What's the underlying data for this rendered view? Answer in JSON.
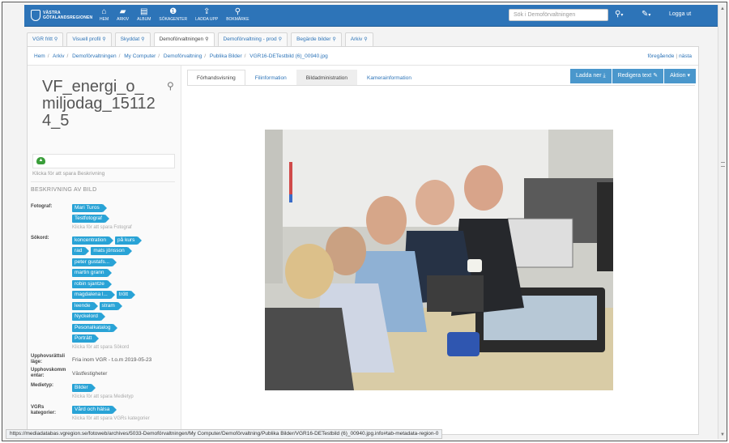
{
  "nav": {
    "logo_line1": "VÄSTRA",
    "logo_line2": "GÖTALANDSREGIONEN",
    "items": [
      {
        "label": "HEM",
        "icon": "home-icon"
      },
      {
        "label": "ARKIV",
        "icon": "folder-icon"
      },
      {
        "label": "ALBUM",
        "icon": "album-icon"
      },
      {
        "label": "SÖKAGENTER",
        "icon": "info-icon"
      },
      {
        "label": "LADDA UPP",
        "icon": "upload-icon"
      },
      {
        "label": "BOKMÄRKE",
        "icon": "pin-icon"
      }
    ],
    "search_placeholder": "Sök i Demoförvaltningen",
    "logout": "Logga ut"
  },
  "tabs": [
    {
      "label": "VGR fritt",
      "active": false
    },
    {
      "label": "Visuell profil",
      "active": false
    },
    {
      "label": "Skyddat",
      "active": false
    },
    {
      "label": "Demoförvaltningen",
      "active": true
    },
    {
      "label": "Demoförvaltning - prod",
      "active": false
    },
    {
      "label": "Begärde bilder",
      "active": false
    },
    {
      "label": "Arkiv",
      "active": false
    }
  ],
  "breadcrumb": [
    "Hem",
    "Arkiv",
    "Demoförvaltningen",
    "My Computer",
    "Demoförvaltning",
    "Publika Bilder",
    "VGR16-DETestbild (6)_00940.jpg"
  ],
  "prev_label": "föregående",
  "next_label": "nästa",
  "asset": {
    "title": "VF_energi_o_miljodag_151124_5",
    "click_description": "Klicka för att spara Beskrivning",
    "section_heading": "BESKRIVNING AV BILD"
  },
  "fields": {
    "photographer": {
      "label": "Fotograf:",
      "tags": [
        "Mari Turos",
        "Testfotograf"
      ],
      "hint": "Klicka för att spara Fotograf"
    },
    "keywords": {
      "label": "Sökord:",
      "rows": [
        [
          "koncentration",
          "på kurs"
        ],
        [
          "rad",
          "mats jönsson"
        ],
        [
          "peter gustafs..."
        ],
        [
          "martin grann"
        ],
        [
          "robin sjantze"
        ],
        [
          "magdalena l...",
          "trött"
        ],
        [
          "leende",
          "stram"
        ],
        [
          "Nyckelord"
        ],
        [
          "Pesonalkatalog"
        ],
        [
          "Porträtt"
        ]
      ],
      "hint": "Klicka för att spara Sökord"
    },
    "copyright": {
      "label": "Upphovsrättsli läge:",
      "value": "Fria inom VGR - t.o.m 2019-05-23"
    },
    "copyright_comment": {
      "label": "Upphovskomm entar:",
      "value": "Västfestigheter"
    },
    "media_type": {
      "label": "Medietyp:",
      "tags": [
        "Bilder"
      ],
      "hint": "Klicka för att spara Medietyp"
    },
    "vgr_categories": {
      "label": "VGRs kategorier:",
      "tags": [
        "Vård och hälsa"
      ],
      "hint": "Klicka för att spara VGRs kategorier"
    }
  },
  "main_tabs": [
    {
      "label": "Förhandsvisning",
      "state": "active"
    },
    {
      "label": "Filinformation",
      "state": "normal"
    },
    {
      "label": "Bildadministration",
      "state": "alt"
    },
    {
      "label": "Kamerainformation",
      "state": "normal"
    }
  ],
  "buttons": {
    "download": "Ladda ner",
    "edit_text": "Redigera text",
    "action": "Aktion"
  },
  "status_url": "https://mediadatabas.vgregion.se/fotoweb/archives/5033-Demoförvaltningen/My Computer/Demoförvaltning/Publika Bilder/VGR16-DETestbild (6)_00940.jpg.info#tab-metadata-region-0"
}
